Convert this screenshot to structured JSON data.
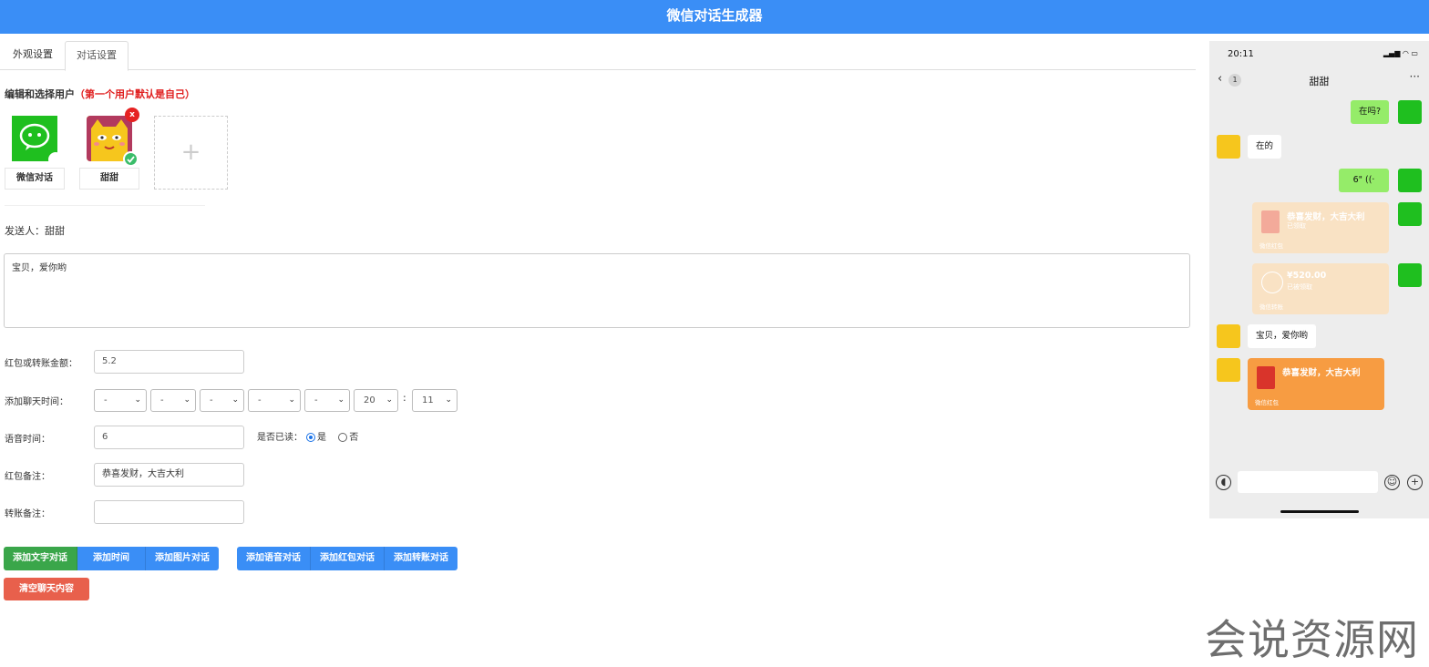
{
  "header": {
    "title": "微信对话生成器"
  },
  "tabs": [
    {
      "label": "外观设置"
    },
    {
      "label": "对话设置"
    }
  ],
  "users_section": {
    "title_prefix": "编辑和选择用户",
    "title_note": "（第一个用户默认是自己）"
  },
  "users": [
    {
      "name": "微信对话",
      "avatar": "wechat-logo"
    },
    {
      "name": "甜甜",
      "avatar": "cat-avatar",
      "delete_label": "x"
    }
  ],
  "add_user": {
    "label": "+"
  },
  "sender": {
    "label": "发送人：",
    "value": "甜甜"
  },
  "message": {
    "value": "宝贝，爱你哟"
  },
  "form": {
    "amount": {
      "label": "红包或转账金额：",
      "value": "5.2"
    },
    "time": {
      "label": "添加聊天时间：",
      "selects": [
        "-",
        "-",
        "-",
        "-",
        "-",
        "20",
        "11"
      ],
      "separator": ":"
    },
    "voice": {
      "label": "语音时间：",
      "value": "6"
    },
    "read": {
      "label": "是否已读：",
      "yes": "是",
      "no": "否",
      "selected": "yes"
    },
    "redpacket_note": {
      "label": "红包备注：",
      "value": "恭喜发财，大吉大利"
    },
    "transfer_note": {
      "label": "转账备注：",
      "value": ""
    }
  },
  "buttons": {
    "group1": [
      "添加文字对话",
      "添加时间",
      "添加图片对话"
    ],
    "group2": [
      "添加语音对话",
      "添加红包对话",
      "添加转账对话"
    ],
    "clear": "清空聊天内容"
  },
  "phone": {
    "time": "20:11",
    "status_icons": "▂▄▆ ◠ ▭",
    "back_badge": "1",
    "chat_title": "甜甜",
    "more": "···",
    "messages": {
      "m1": "在吗?",
      "m2": "在的",
      "m3": "6\" ((·",
      "rp_faded": {
        "title": "恭喜发财，大吉大利",
        "sub": "已领取",
        "foot": "微信红包"
      },
      "tf_faded": {
        "title": "¥520.00",
        "sub": "已被领取",
        "foot": "微信转账"
      },
      "m4": "宝贝，爱你哟",
      "rp_active": {
        "title": "恭喜发财，大吉大利",
        "foot": "微信红包"
      }
    }
  },
  "colors": {
    "accent": "#3a8ef6",
    "green": "#3aa64a",
    "danger": "#e8604c",
    "bubble_me": "#95ec69",
    "redpacket": "#f79c42"
  },
  "watermark": "会说资源网"
}
